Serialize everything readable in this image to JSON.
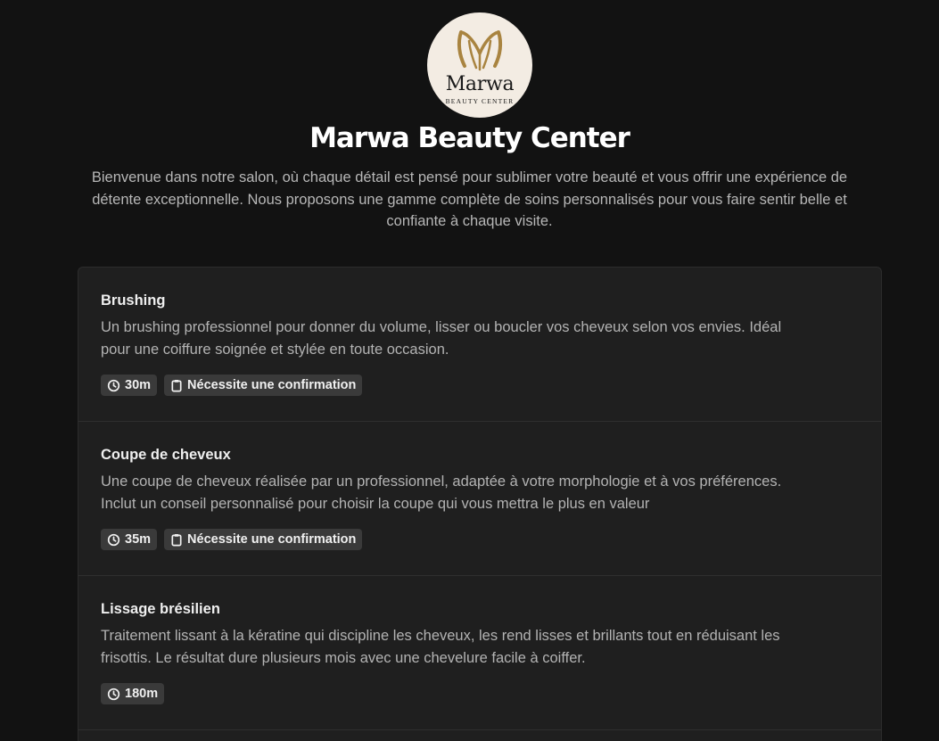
{
  "brand": {
    "logo_word": "Marwa",
    "logo_sub": "BEAUTY CENTER",
    "logo_gold": "#a98440",
    "title": "Marwa Beauty Center",
    "intro": "Bienvenue dans notre salon, où chaque détail est pensé pour sublimer votre beauté et vous offrir une expérience de détente exceptionnelle. Nous proposons une gamme complète de soins personnalisés pour vous faire sentir belle et confiante à chaque visite."
  },
  "services": [
    {
      "name": "Brushing",
      "description": "Un brushing professionnel pour donner du volume, lisser ou boucler vos cheveux selon vos envies. Idéal pour une coiffure soignée et stylée en toute occasion.",
      "duration": "30m",
      "confirmation": "Nécessite une confirmation"
    },
    {
      "name": "Coupe de cheveux",
      "description": "Une coupe de cheveux réalisée par un professionnel, adaptée à votre morphologie et à vos préférences. Inclut un conseil personnalisé pour choisir la coupe qui vous mettra le plus en valeur",
      "duration": "35m",
      "confirmation": "Nécessite une confirmation"
    },
    {
      "name": "Lissage brésilien",
      "description": "Traitement lissant à la kératine qui discipline les cheveux, les rend lisses et brillants tout en réduisant les frisottis. Le résultat dure plusieurs mois avec une chevelure facile à coiffer.",
      "duration": "180m"
    }
  ],
  "icons": {
    "duration": "clock-icon",
    "confirmation": "clipboard-icon"
  }
}
